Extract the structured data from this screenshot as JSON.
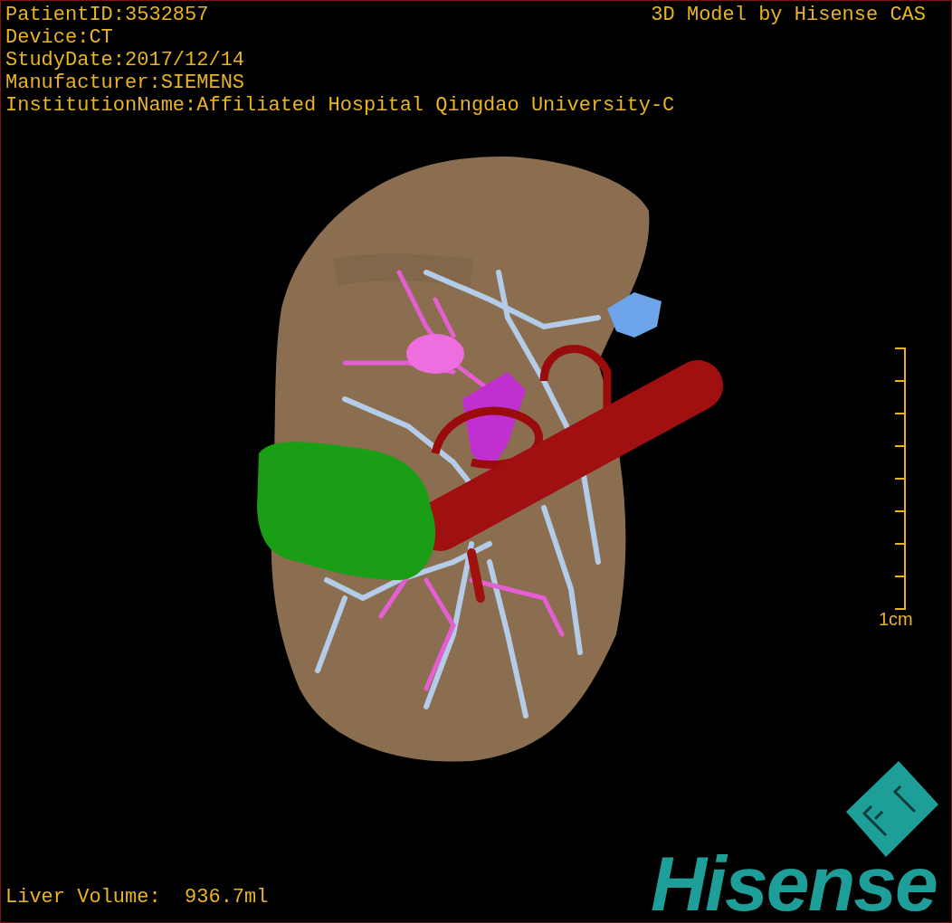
{
  "patient_info": [
    "PatientID:3532857",
    "Device:CT",
    "StudyDate:2017/12/14",
    "Manufacturer:SIEMENS",
    "InstitutionName:Affiliated Hospital Qingdao University-C"
  ],
  "title": "3D Model by Hisense CAS",
  "scale_bar": {
    "label": "1cm"
  },
  "measurement": "Liver Volume:  936.7ml",
  "logo": {
    "wordmark": "Hisense"
  }
}
